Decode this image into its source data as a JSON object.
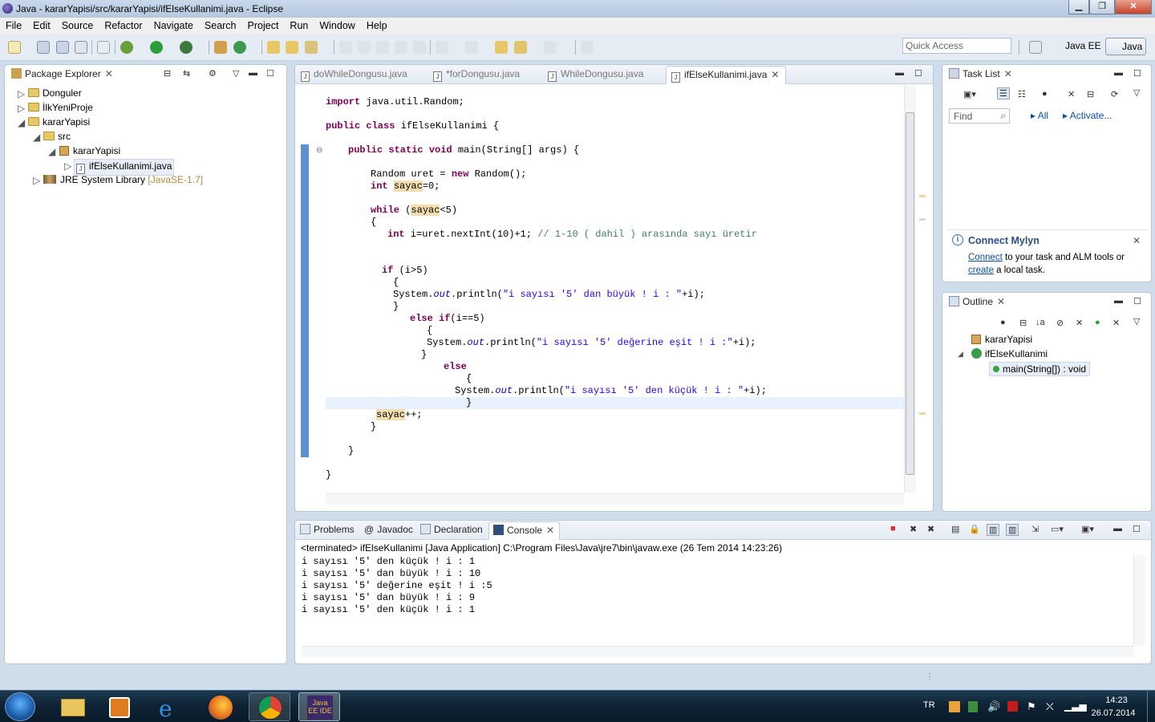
{
  "window": {
    "title": "Java - kararYapisi/src/kararYapisi/ifElseKullanimi.java - Eclipse"
  },
  "menu": [
    "File",
    "Edit",
    "Source",
    "Refactor",
    "Navigate",
    "Search",
    "Project",
    "Run",
    "Window",
    "Help"
  ],
  "toolbar": {
    "quick_access_placeholder": "Quick Access",
    "perspective_javaee": "Java EE",
    "perspective_java": "Java"
  },
  "package_explorer": {
    "title": "Package Explorer",
    "items": [
      {
        "label": "Donguler"
      },
      {
        "label": "İlkYeniProje"
      },
      {
        "label": "kararYapisi"
      },
      {
        "label": "src"
      },
      {
        "label": "kararYapisi"
      },
      {
        "label": "ifElseKullanimi.java"
      },
      {
        "label": "JRE System Library",
        "suffix": "[JavaSE-1.7]"
      }
    ]
  },
  "editor": {
    "tabs": [
      {
        "label": "doWhileDongusu.java"
      },
      {
        "label": "*forDongusu.java"
      },
      {
        "label": "WhileDongusu.java"
      },
      {
        "label": "ifElseKullanimi.java"
      }
    ],
    "code": {
      "l1_kw": "import",
      "l1_rest": " java.util.Random;",
      "l2_kw": "public class",
      "l2_rest": " ifElseKullanimi {",
      "l3_kw": "public static void",
      "l3_rest": " main(String[] args) {",
      "l4_a": "Random uret = ",
      "l4_kw": "new",
      "l4_b": " Random();",
      "l5_kw": "int",
      "l5_var": "sayac",
      "l5_rest": "=0;",
      "l6_kw": "while",
      "l6_a": " (",
      "l6_var": "sayac",
      "l6_b": "<5)",
      "l7": "{",
      "l8_kw": "int",
      "l8_rest": " i=uret.nextInt(10)+1; ",
      "l8_cm": "// 1-10 ( dahil ) arasında sayı üretir",
      "l9_kw": "if",
      "l9_rest": " (i>5)",
      "l10": "{",
      "l11_a": "System.",
      "l11_out": "out",
      "l11_b": ".println(",
      "l11_str": "\"i sayısı '5' dan büyük ! i : \"",
      "l11_c": "+i);",
      "l12": "}",
      "l13_kw": "else if",
      "l13_rest": "(i==5)",
      "l14": "{",
      "l15_a": "System.",
      "l15_out": "out",
      "l15_b": ".println(",
      "l15_str": "\"i sayısı '5' değerine eşit ! i :\"",
      "l15_c": "+i);",
      "l16": "}",
      "l17_kw": "else",
      "l18": "{",
      "l19_a": "System.",
      "l19_out": "out",
      "l19_b": ".println(",
      "l19_str": "\"i sayısı '5' den küçük ! i : \"",
      "l19_c": "+i);",
      "l20": "}",
      "l21_var": "sayac",
      "l21_rest": "++;",
      "l22": "}",
      "l23": "}",
      "l24": "}"
    }
  },
  "task_list": {
    "title": "Task List",
    "find_placeholder": "Find",
    "all_label": "All",
    "activate_label": "Activate..."
  },
  "mylyn": {
    "title": "Connect Mylyn",
    "connect_link": "Connect",
    "text1": " to your task and ALM tools or",
    "create_link": "create",
    "text2": " a local task."
  },
  "outline": {
    "title": "Outline",
    "items": [
      {
        "label": "kararYapisi"
      },
      {
        "label": "ifElseKullanimi"
      },
      {
        "label": "main(String[]) : void"
      }
    ]
  },
  "bottom": {
    "tabs": [
      {
        "label": "Problems"
      },
      {
        "label": "Javadoc"
      },
      {
        "label": "Declaration"
      },
      {
        "label": "Console"
      }
    ],
    "console_header": "<terminated> ifElseKullanimi [Java Application] C:\\Program Files\\Java\\jre7\\bin\\javaw.exe (26 Tem 2014 14:23:26)",
    "console_lines": [
      "i sayısı '5' den küçük ! i : 1",
      "i sayısı '5' dan büyük ! i : 10",
      "i sayısı '5' değerine eşit ! i :5",
      "i sayısı '5' dan büyük ! i : 9",
      "i sayısı '5' den küçük ! i : 1"
    ]
  },
  "taskbar": {
    "lang": "TR",
    "time": "14:23",
    "date": "26.07.2014",
    "eclipse_label": "Java EE IDE"
  }
}
